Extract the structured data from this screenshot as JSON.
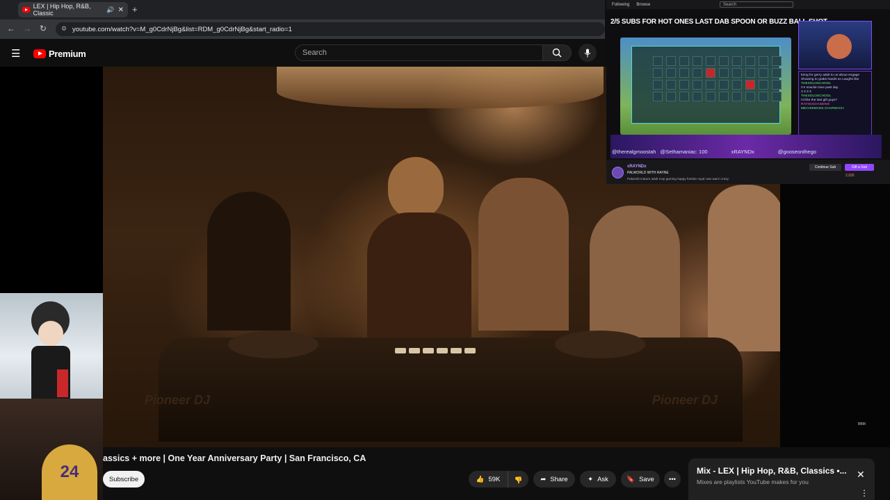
{
  "browser": {
    "tab_title": "LEX | Hip Hop, R&B, Classic",
    "new_tab": "+",
    "url": "youtube.com/watch?v=M_g0CdrNjBg&list=RDM_g0CdrNjBg&start_radio=1"
  },
  "youtube": {
    "logo_text": "Premium",
    "search_placeholder": "Search"
  },
  "video": {
    "brand_left": "Pioneer DJ",
    "brand_right": "Pioneer DJ",
    "title": "assics + more | One Year Anniversary Party | San Francisco, CA",
    "subscribe": "Subscribe",
    "likes": "59K",
    "share": "Share",
    "ask": "Ask",
    "save": "Save",
    "watermark": "BBM"
  },
  "mix_panel": {
    "title": "Mix - LEX | Hip Hop, R&B, Classics •...",
    "subtitle": "Mixes are playlists YouTube makes for you"
  },
  "webcam": {
    "jersey_number": "24"
  },
  "stream": {
    "top_items": [
      "Following",
      "Browse"
    ],
    "search_placeholder": "Search",
    "goal_text": "2/5 SUBS FOR HOT ONES LAST DAB SPOON OR BUZZ BALL SHOT",
    "chat_lines": [
      "bring for gerry adult to us about engage",
      "Showing to grabs hands so Laughs like",
      "THESOLOSCHOOL",
      "I'm snackin lace past day",
      "3 3 3 3",
      "THESOLOSCHOOL",
      "I'd like the last gift guys?",
      "RAYNOCHASEINS",
      "MECHIEMANS CHARMACH"
    ],
    "banner_names": [
      "@therealgmoostah",
      "@Sethamaniac: 100",
      "xRAYNDx",
      "@gooseonthego"
    ],
    "streamer_name": "xRAYNDx",
    "stream_title": "PALWORLD WITH RAYNE",
    "stream_tags": [
      "Palworld",
      "mature",
      "adult",
      "mvp",
      "gaming",
      "happy",
      "fortnite",
      "royal",
      "cute",
      "warm",
      "crazy"
    ],
    "subscribe_label": "Continue Sub",
    "follow_label": "Gift a Sub",
    "viewers": "2,926"
  }
}
